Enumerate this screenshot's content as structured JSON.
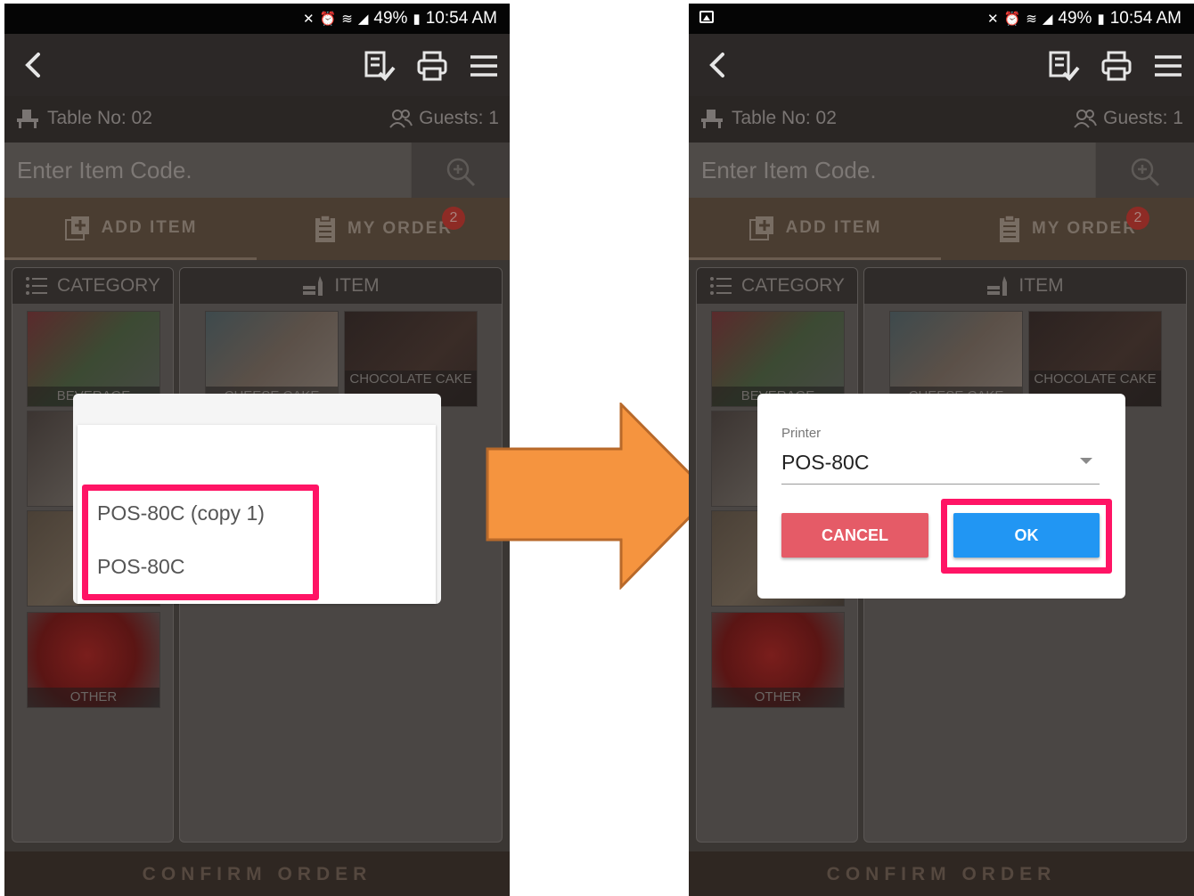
{
  "status_bar": {
    "battery": "49%",
    "time": "10:54 AM"
  },
  "info": {
    "table_no": "Table No: 02",
    "guests": "Guests: 1"
  },
  "search": {
    "placeholder": "Enter Item Code."
  },
  "tabs": {
    "add_item": "ADD ITEM",
    "my_order": "MY ORDER",
    "order_badge": "2"
  },
  "panels": {
    "category": "CATEGORY",
    "item": "ITEM"
  },
  "categories": [
    {
      "label": "BEVERAGE"
    },
    {
      "label": ""
    },
    {
      "label": ""
    },
    {
      "label": "OTHER"
    }
  ],
  "items": [
    {
      "label": "CHEESE CAKE"
    },
    {
      "label": "CHOCOLATE CAKE"
    }
  ],
  "confirm_label": "CONFIRM ORDER",
  "printer_list": {
    "options": [
      "POS-80C (copy 1)",
      "POS-80C"
    ]
  },
  "printer_dialog": {
    "label": "Printer",
    "value": "POS-80C",
    "cancel_label": "CANCEL",
    "ok_label": "OK"
  },
  "colors": {
    "highlight": "#ff1465",
    "arrow": "#f5943f",
    "ok_button": "#2196f3",
    "cancel_button": "#e55b67"
  }
}
